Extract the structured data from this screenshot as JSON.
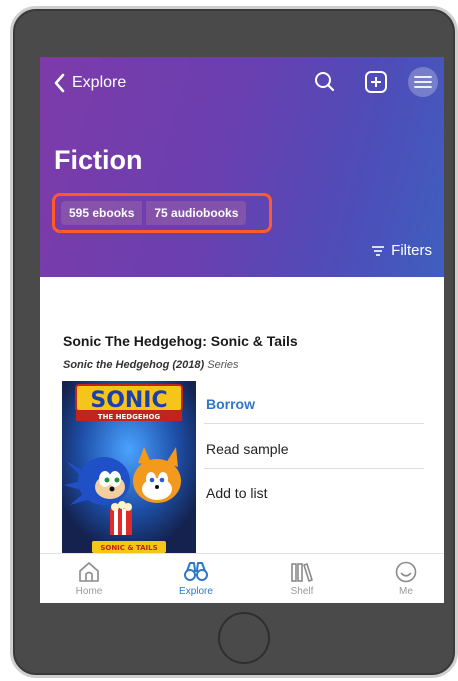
{
  "header": {
    "back_label": "Explore",
    "title": "Fiction",
    "filters_label": "Filters"
  },
  "chips": {
    "ebooks": "595 ebooks",
    "audiobooks": "75 audiobooks"
  },
  "book": {
    "title": "Sonic The Hedgehog: Sonic & Tails",
    "series_name": "Sonic the Hedgehog (2018)",
    "series_word": "Series",
    "cover_logo": "SONIC",
    "cover_subtitle": "THE HEDGEHOG",
    "cover_bottom": "SONIC & TAILS"
  },
  "actions": {
    "borrow": "Borrow",
    "read_sample": "Read sample",
    "add_to_list": "Add to list"
  },
  "tabs": [
    {
      "label": "Home",
      "icon": "home-icon",
      "active": false
    },
    {
      "label": "Explore",
      "icon": "binoculars-icon",
      "active": true
    },
    {
      "label": "Shelf",
      "icon": "books-icon",
      "active": false
    },
    {
      "label": "Me",
      "icon": "smiley-icon",
      "active": false
    }
  ],
  "colors": {
    "accent": "#2f77c9",
    "highlight_border": "#ff5a2a",
    "hero_start": "#7d3ba9",
    "hero_end": "#3f5fbf"
  }
}
